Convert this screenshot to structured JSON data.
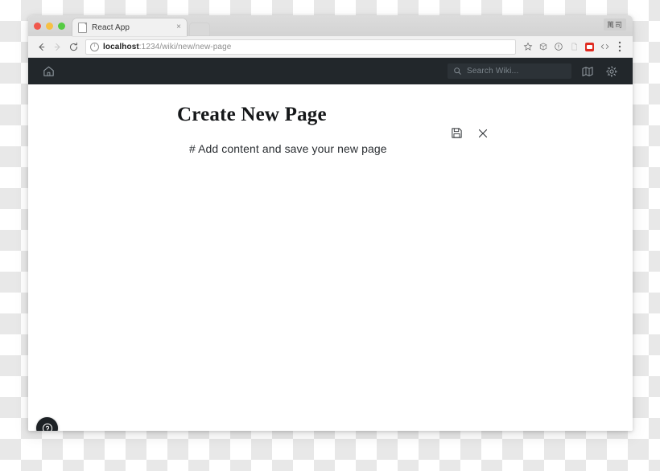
{
  "browser": {
    "tab": {
      "title": "React App",
      "close_label": "×",
      "favicon": "page-icon"
    },
    "profile_label": "萬司",
    "nav": {
      "back": "back-arrow",
      "forward": "forward-arrow",
      "reload": "reload-arrow"
    },
    "omnibox": {
      "security_icon": "info-circle-icon",
      "url_host": "localhost",
      "url_rest": ":1234/wiki/new/new-page",
      "full_url": "localhost:1234/wiki/new/new-page"
    },
    "toolbar_icons": [
      "bookmark-star-icon",
      "extension-cube-icon",
      "info-circle-icon",
      "page-extension-icon",
      "red-extension-icon",
      "code-brackets-icon",
      "three-dot-menu-icon"
    ]
  },
  "app": {
    "navbar": {
      "home_icon": "home-icon",
      "search": {
        "icon": "search-icon",
        "placeholder": "Search Wiki...",
        "value": ""
      },
      "map_icon": "map-icon",
      "settings_icon": "gear-icon"
    },
    "page": {
      "title": "Create New Page",
      "editor_content": "# Add content and save your new page",
      "actions": {
        "save_icon": "floppy-disk-save-icon",
        "cancel_icon": "close-x-icon"
      },
      "help_icon": "question-mark-help-icon"
    }
  },
  "colors": {
    "navbar_bg": "#22272b",
    "search_bg": "#2c3237",
    "page_bg": "#ffffff",
    "title_color": "#16181a",
    "extension_accent": "#e02b20"
  }
}
